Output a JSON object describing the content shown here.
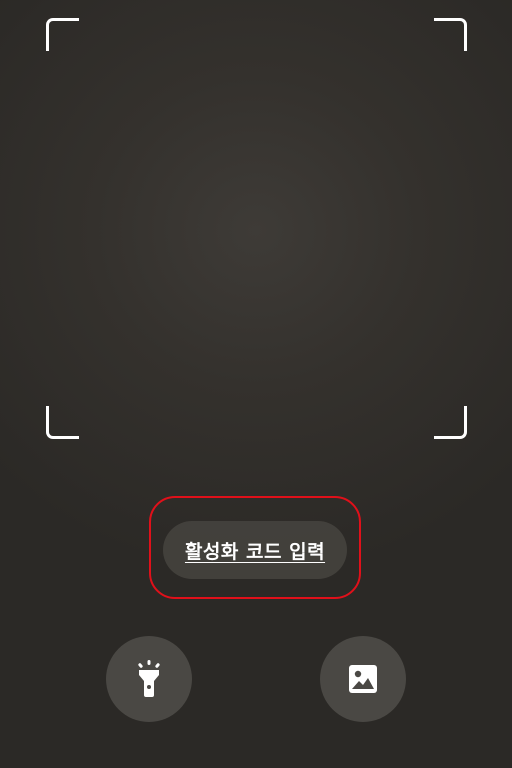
{
  "scanner": {
    "activation_code_label": "활성화 코드 입력"
  },
  "controls": {
    "flashlight_icon": "flashlight-icon",
    "gallery_icon": "image-gallery-icon"
  },
  "colors": {
    "highlight_ring": "#e0101a",
    "background": "#34312d",
    "button_fill": "#4a4844",
    "foreground": "#ffffff"
  }
}
